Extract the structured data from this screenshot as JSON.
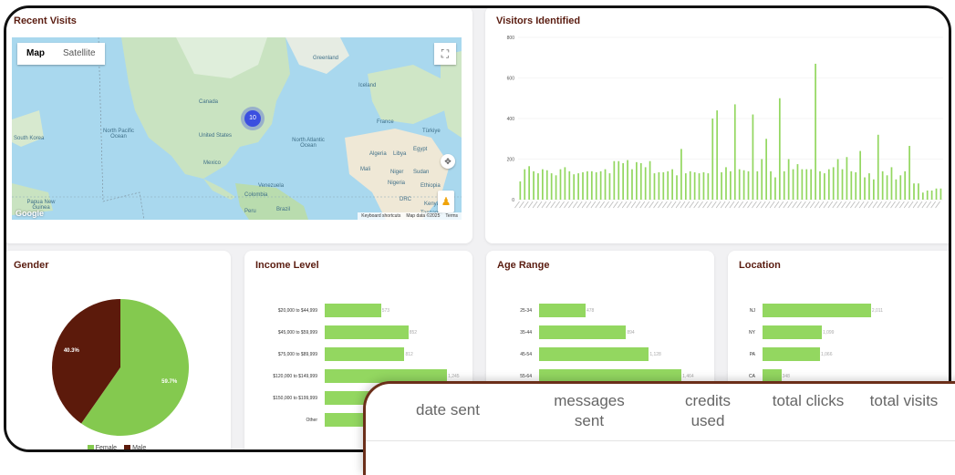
{
  "recent_visits": {
    "title": "Recent Visits",
    "map_type_map": "Map",
    "map_type_satellite": "Satellite",
    "cluster_count": "10",
    "labels": [
      {
        "text": "North Pacific Ocean"
      },
      {
        "text": "North Atlantic Ocean"
      },
      {
        "text": "Canada"
      },
      {
        "text": "United States"
      },
      {
        "text": "Mexico"
      },
      {
        "text": "Brazil"
      },
      {
        "text": "Greenland"
      },
      {
        "text": "Iceland"
      },
      {
        "text": "France"
      },
      {
        "text": "Algeria"
      },
      {
        "text": "Libya"
      },
      {
        "text": "Egypt"
      },
      {
        "text": "Niger"
      },
      {
        "text": "Nigeria"
      },
      {
        "text": "Sudan"
      },
      {
        "text": "Ethiopia"
      },
      {
        "text": "Kenya"
      },
      {
        "text": "Türkiye"
      },
      {
        "text": "DRC"
      },
      {
        "text": "Tanzania"
      },
      {
        "text": "Venezuela"
      },
      {
        "text": "Colombia"
      },
      {
        "text": "Peru"
      },
      {
        "text": "Papua New Guinea"
      },
      {
        "text": "South Korea"
      },
      {
        "text": "Mali"
      }
    ],
    "footer_shortcuts": "Keyboard shortcuts",
    "footer_data": "Map data ©2025",
    "footer_terms": "Terms",
    "google_logo": "Google"
  },
  "visitors_identified": {
    "title": "Visitors Identified",
    "chart_data": {
      "type": "bar",
      "ylim": [
        0,
        800
      ],
      "y_ticks": [
        "0",
        "200",
        "400",
        "600",
        "800"
      ],
      "values": [
        90,
        150,
        165,
        140,
        130,
        150,
        145,
        130,
        120,
        150,
        160,
        140,
        125,
        130,
        135,
        140,
        140,
        135,
        140,
        150,
        130,
        190,
        190,
        180,
        195,
        150,
        185,
        180,
        160,
        190,
        130,
        135,
        135,
        140,
        150,
        120,
        250,
        130,
        140,
        135,
        130,
        135,
        130,
        400,
        440,
        135,
        160,
        140,
        470,
        150,
        145,
        140,
        420,
        140,
        200,
        300,
        140,
        110,
        500,
        140,
        200,
        150,
        175,
        150,
        150,
        150,
        670,
        140,
        130,
        150,
        160,
        200,
        150,
        210,
        140,
        135,
        240,
        110,
        130,
        100,
        320,
        140,
        120,
        160,
        100,
        120,
        140,
        265,
        80,
        80,
        35,
        45,
        45,
        55,
        55
      ],
      "bar_color": "#93d760"
    }
  },
  "gender": {
    "title": "Gender",
    "chart_data": {
      "type": "pie",
      "slices": [
        {
          "name": "Female",
          "value": 59.7,
          "label": "59.7%",
          "color": "#84c94f"
        },
        {
          "name": "Male",
          "value": 40.3,
          "label": "40.3%",
          "color": "#5c1a0b"
        }
      ],
      "legend": [
        "Female",
        "Male"
      ]
    }
  },
  "income_level": {
    "title": "Income Level",
    "chart_data": {
      "type": "bar",
      "orientation": "horizontal",
      "categories": [
        "$20,000 to $44,999",
        "$45,000 to $59,999",
        "$75,000 to $89,999",
        "$120,000 to $149,999",
        "$150,000 to $199,999",
        "Other"
      ],
      "values": [
        573,
        852,
        812,
        1245,
        1000,
        1000
      ],
      "value_labels": [
        "573",
        "852",
        "812",
        "1,245",
        "",
        ""
      ],
      "xlim": [
        0,
        1300
      ]
    }
  },
  "age_range": {
    "title": "Age Range",
    "chart_data": {
      "type": "bar",
      "orientation": "horizontal",
      "categories": [
        "25-34",
        "35-44",
        "45-54",
        "55-64"
      ],
      "values": [
        478,
        894,
        1128,
        1464
      ],
      "value_labels": [
        "478",
        "894",
        "1,128",
        "1,464"
      ],
      "xlim": [
        0,
        1500
      ]
    }
  },
  "location": {
    "title": "Location",
    "chart_data": {
      "type": "bar",
      "orientation": "horizontal",
      "categories": [
        "NJ",
        "NY",
        "PA",
        "CA"
      ],
      "values": [
        2011,
        1099,
        1066,
        348
      ],
      "value_labels": [
        "2,011",
        "1,099",
        "1,066",
        "348"
      ],
      "xlim": [
        0,
        2200
      ]
    }
  },
  "overlay_table": {
    "headers": [
      "date sent",
      "messages sent",
      "credits used",
      "total clicks",
      "total visits"
    ]
  }
}
